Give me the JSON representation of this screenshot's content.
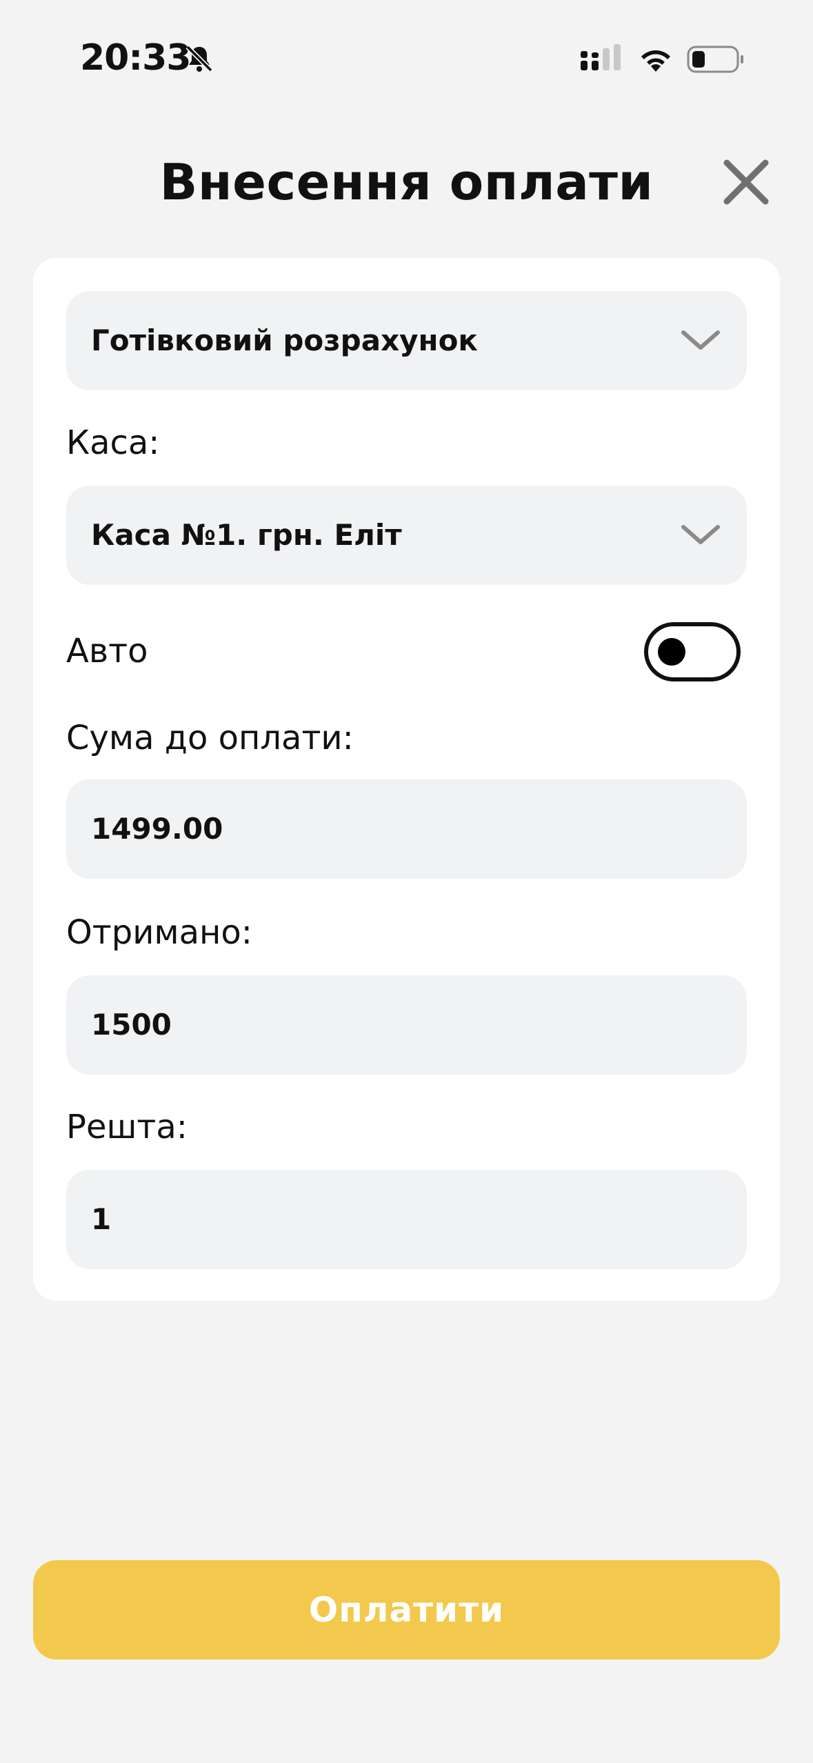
{
  "status_bar": {
    "time": "20:33",
    "icons": [
      "bell-muted-icon",
      "cellular-signal-icon",
      "wifi-icon",
      "battery-icon"
    ]
  },
  "header": {
    "title": "Внесення оплати",
    "close_icon": "close-icon"
  },
  "form": {
    "payment_type": {
      "value": "Готівковий розрахунок"
    },
    "cashbox": {
      "label": "Каса:",
      "value": "Каса №1. грн. Еліт"
    },
    "auto": {
      "label": "Авто",
      "enabled": false
    },
    "amount_due": {
      "label": "Сума до оплати:",
      "value": "1499.00"
    },
    "received": {
      "label": "Отримано:",
      "value": "1500"
    },
    "change": {
      "label": "Решта:",
      "value": "1"
    }
  },
  "actions": {
    "pay_label": "Оплатити"
  },
  "colors": {
    "background": "#f3f3f4",
    "card": "#ffffff",
    "field": "#f1f2f4",
    "accent": "#f2c94c"
  }
}
